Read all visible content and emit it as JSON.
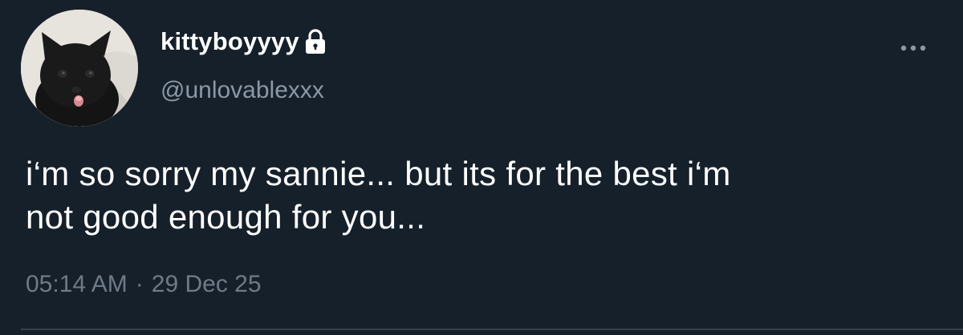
{
  "tweet": {
    "author": {
      "display_name": "kittyboyyyy",
      "handle": "@unlovablexxx",
      "protected_icon": "lock-icon",
      "avatar": "black-kitten-avatar"
    },
    "text_lines": [
      "i‘m so sorry my sannie... but its for the best i‘m",
      "not good enough for you..."
    ],
    "time": "05:14 AM",
    "separator": "·",
    "date": "29 Dec 25",
    "more_icon": "more-horizontal-icon"
  },
  "colors": {
    "background": "#15202b",
    "primary_text": "#ffffff",
    "secondary_text": "#8b98a5",
    "meta_text": "#6e7b87",
    "divider": "#38444d"
  }
}
